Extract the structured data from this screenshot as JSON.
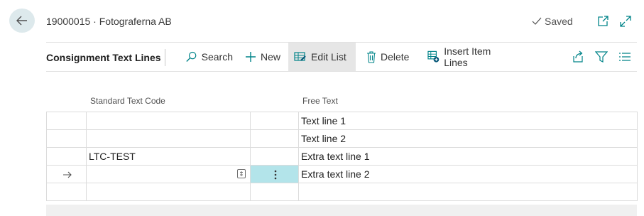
{
  "header": {
    "title": "19000015 · Fotograferna AB",
    "status": "Saved"
  },
  "actionbar": {
    "caption": "Consignment Text Lines",
    "search": "Search",
    "new": "New",
    "edit_list": "Edit List",
    "delete": "Delete",
    "insert_item_lines": "Insert Item Lines"
  },
  "table": {
    "columns": [
      "Standard Text Code",
      "Free Text"
    ],
    "rows": [
      {
        "code": "",
        "text": "Text line 1",
        "current": false
      },
      {
        "code": "",
        "text": "Text line 2",
        "current": false
      },
      {
        "code": "LTC-TEST",
        "text": "Extra text line 1",
        "current": false
      },
      {
        "code": "",
        "text": "Extra text line 2",
        "current": true
      },
      {
        "code": "",
        "text": "",
        "current": false
      }
    ]
  },
  "colors": {
    "accent": "#008489",
    "selected_cell": "#b3e4ea",
    "back_button": "#dde9ec"
  }
}
